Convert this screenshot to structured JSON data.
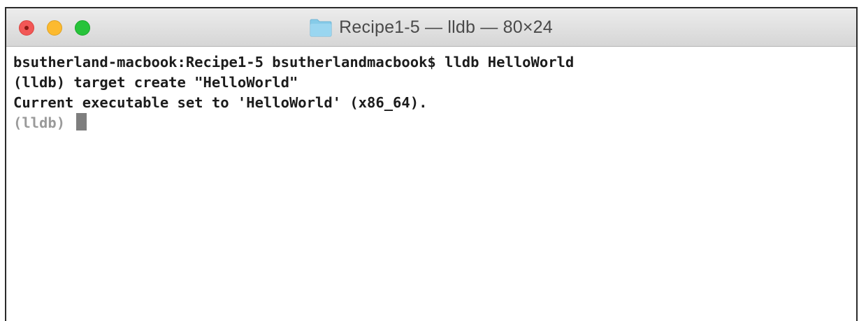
{
  "window": {
    "title": "Recipe1-5 — lldb — 80×24",
    "icon": "folder-icon",
    "colors": {
      "close": "#f25756",
      "minimize": "#fcba2f",
      "zoom": "#27c33a",
      "folder": "#7fc6e4"
    }
  },
  "terminal": {
    "lines": [
      "bsutherland-macbook:Recipe1-5 bsutherlandmacbook$ lldb HelloWorld",
      "(lldb) target create \"HelloWorld\"",
      "Current executable set to 'HelloWorld' (x86_64)."
    ],
    "prompt": "(lldb) "
  }
}
